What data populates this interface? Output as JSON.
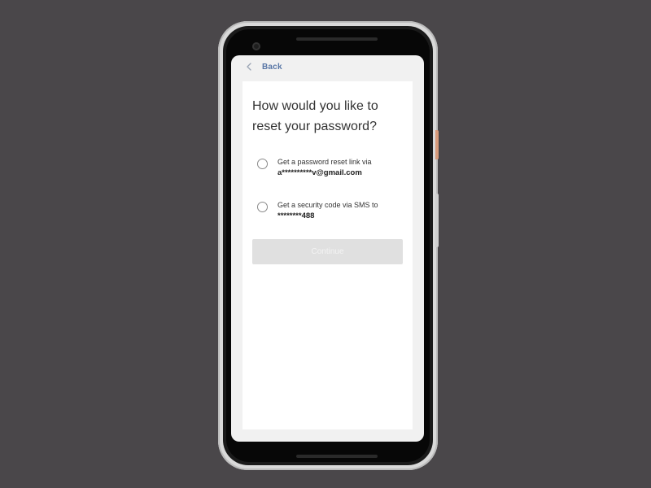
{
  "header": {
    "back_label": "Back",
    "back_icon": "chevron-left-icon"
  },
  "main": {
    "title": "How would you like to reset your password?",
    "options": [
      {
        "line1": "Get a password reset link via",
        "line2": "a**********v@gmail.com",
        "selected": false
      },
      {
        "line1": "Get a security code via SMS to",
        "line2": "********488",
        "selected": false
      }
    ],
    "continue_label": "Continue",
    "continue_enabled": false
  },
  "colors": {
    "background": "#4a474a",
    "screen": "#f1f1f1",
    "card": "#ffffff",
    "accent_link": "#5876a6",
    "button_disabled": "#e0e0e0"
  }
}
